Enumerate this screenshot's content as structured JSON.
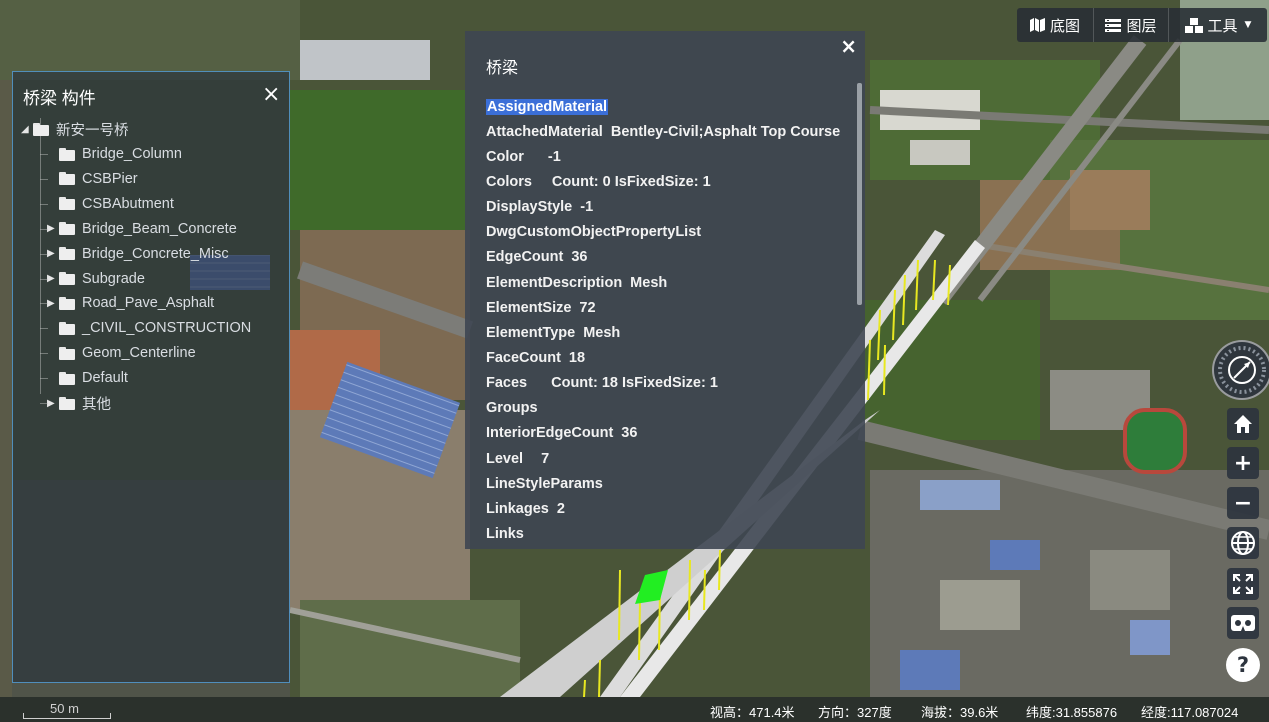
{
  "tree_panel": {
    "title": "桥梁 构件",
    "close": "×",
    "root": "新安一号桥",
    "items": [
      {
        "label": "Bridge_Column",
        "expandable": false
      },
      {
        "label": "CSBPier",
        "expandable": false
      },
      {
        "label": "CSBAbutment",
        "expandable": false
      },
      {
        "label": "Bridge_Beam_Concrete",
        "expandable": true
      },
      {
        "label": "Bridge_Concrete_Misc",
        "expandable": true
      },
      {
        "label": "Subgrade",
        "expandable": true
      },
      {
        "label": "Road_Pave_Asphalt",
        "expandable": true
      },
      {
        "label": "_CIVIL_CONSTRUCTION",
        "expandable": false
      },
      {
        "label": "Geom_Centerline",
        "expandable": false
      },
      {
        "label": "Default",
        "expandable": false
      },
      {
        "label": "其他",
        "expandable": true
      }
    ]
  },
  "prop_panel": {
    "title": "桥梁",
    "close": "×",
    "rows": [
      {
        "key": "AssignedMaterial",
        "value": "",
        "selected": true
      },
      {
        "key": "AttachedMaterial",
        "value": "Bentley-Civil;Asphalt Top Course"
      },
      {
        "key": "Color",
        "value": "-1",
        "gap": 24
      },
      {
        "key": "Colors",
        "value": "Count: 0 IsFixedSize: 1",
        "gap": 20
      },
      {
        "key": "DisplayStyle",
        "value": "-1"
      },
      {
        "key": "DwgCustomObjectPropertyList",
        "value": ""
      },
      {
        "key": "EdgeCount",
        "value": "36"
      },
      {
        "key": "ElementDescription",
        "value": "Mesh"
      },
      {
        "key": "ElementSize",
        "value": "72"
      },
      {
        "key": "ElementType",
        "value": "Mesh"
      },
      {
        "key": "FaceCount",
        "value": "18"
      },
      {
        "key": "Faces",
        "value": "Count: 18 IsFixedSize: 1",
        "gap": 24
      },
      {
        "key": "Groups",
        "value": ""
      },
      {
        "key": "InteriorEdgeCount",
        "value": "36"
      },
      {
        "key": "Level",
        "value": "7",
        "gap": 18
      },
      {
        "key": "LineStyleParams",
        "value": ""
      },
      {
        "key": "Linkages",
        "value": "2"
      },
      {
        "key": "Links",
        "value": ""
      }
    ]
  },
  "toolbar": {
    "basemap": "底图",
    "layers": "图层",
    "tools": "工具"
  },
  "nav": {
    "home_icon": "home-icon",
    "zoom_in": "+",
    "zoom_out": "−",
    "help": "?"
  },
  "status": {
    "scale": "50 m",
    "view_height": "视高：471.4米",
    "heading": "方向：327度",
    "altitude": "海拔：39.6米",
    "latitude": "纬度:31.855876",
    "longitude": "经度:117.087024"
  },
  "colors": {
    "panel_border": "#5aaae6",
    "selection": "#3b6fd8",
    "highlight_green": "#22ee22",
    "pier_yellow": "#e8e820"
  }
}
